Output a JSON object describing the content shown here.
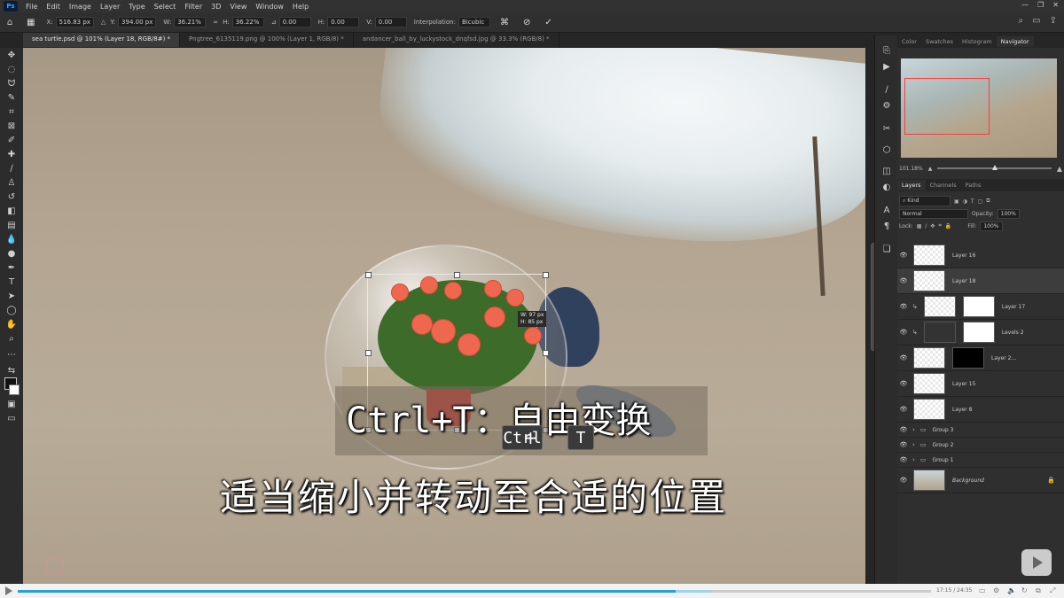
{
  "app": {
    "logo": "Ps"
  },
  "menu": [
    "File",
    "Edit",
    "Image",
    "Layer",
    "Type",
    "Select",
    "Filter",
    "3D",
    "View",
    "Window",
    "Help"
  ],
  "options": {
    "x_label": "X:",
    "x_value": "516.83 px",
    "y_label": "Y:",
    "y_value": "394.00 px",
    "w_label": "W:",
    "w_value": "36.21%",
    "h_label": "H:",
    "h_value": "36.22%",
    "rot_label": "⊿",
    "rot_value": "0.00",
    "hs_label": "H:",
    "hs_value": "0.00",
    "vs_label": "V:",
    "vs_value": "0.00",
    "interp_label": "Interpolation:",
    "interp_value": "Bicubic"
  },
  "tabs": [
    {
      "label": "sea turtle.psd @ 101% (Layer 18, RGB/8#) *",
      "active": true
    },
    {
      "label": "Pngtree_6135119.png @ 100% (Layer 1, RGB/8) *",
      "active": false
    },
    {
      "label": "andancer_ball_by_luckystock_dnqfsd.jpg @ 33.3% (RGB/8) *",
      "active": false
    }
  ],
  "transform_readout": {
    "line1": "W: 97 px",
    "line2": "H: 85 px"
  },
  "subtitles": {
    "line1": "Ctrl+T：自由变换",
    "key1": "Ctrl",
    "plus": "+",
    "key2": "T",
    "line2": "适当缩小并转动至合适的位置"
  },
  "navigator": {
    "tabs": [
      "Color",
      "Swatches",
      "Histogram",
      "Navigator"
    ],
    "zoom": "101.18%"
  },
  "layers_panel": {
    "tabs": [
      "Layers",
      "Channels",
      "Paths"
    ],
    "kind": "Kind",
    "blend": "Normal",
    "opacity_label": "Opacity:",
    "opacity": "100%",
    "lock_label": "Lock:",
    "fill_label": "Fill:",
    "fill": "100%",
    "layers": [
      {
        "name": "Layer 16",
        "type": "pixel",
        "selected": false
      },
      {
        "name": "Layer 18",
        "type": "pixel",
        "selected": true
      },
      {
        "name": "Layer 17",
        "type": "masked",
        "selected": false
      },
      {
        "name": "Levels 2",
        "type": "adjustment",
        "selected": false
      },
      {
        "name": "Layer 2...",
        "type": "masked-dark",
        "selected": false
      },
      {
        "name": "Layer 15",
        "type": "pixel",
        "selected": false
      },
      {
        "name": "Layer 8",
        "type": "pixel",
        "selected": false
      },
      {
        "name": "Group 3",
        "type": "group",
        "selected": false
      },
      {
        "name": "Group 2",
        "type": "group",
        "selected": false
      },
      {
        "name": "Group 1",
        "type": "group",
        "selected": false
      },
      {
        "name": "Background",
        "type": "background",
        "selected": false
      }
    ]
  },
  "video": {
    "time": "17:15 / 24:35",
    "progress": 0.72,
    "buffered": 0.76
  }
}
